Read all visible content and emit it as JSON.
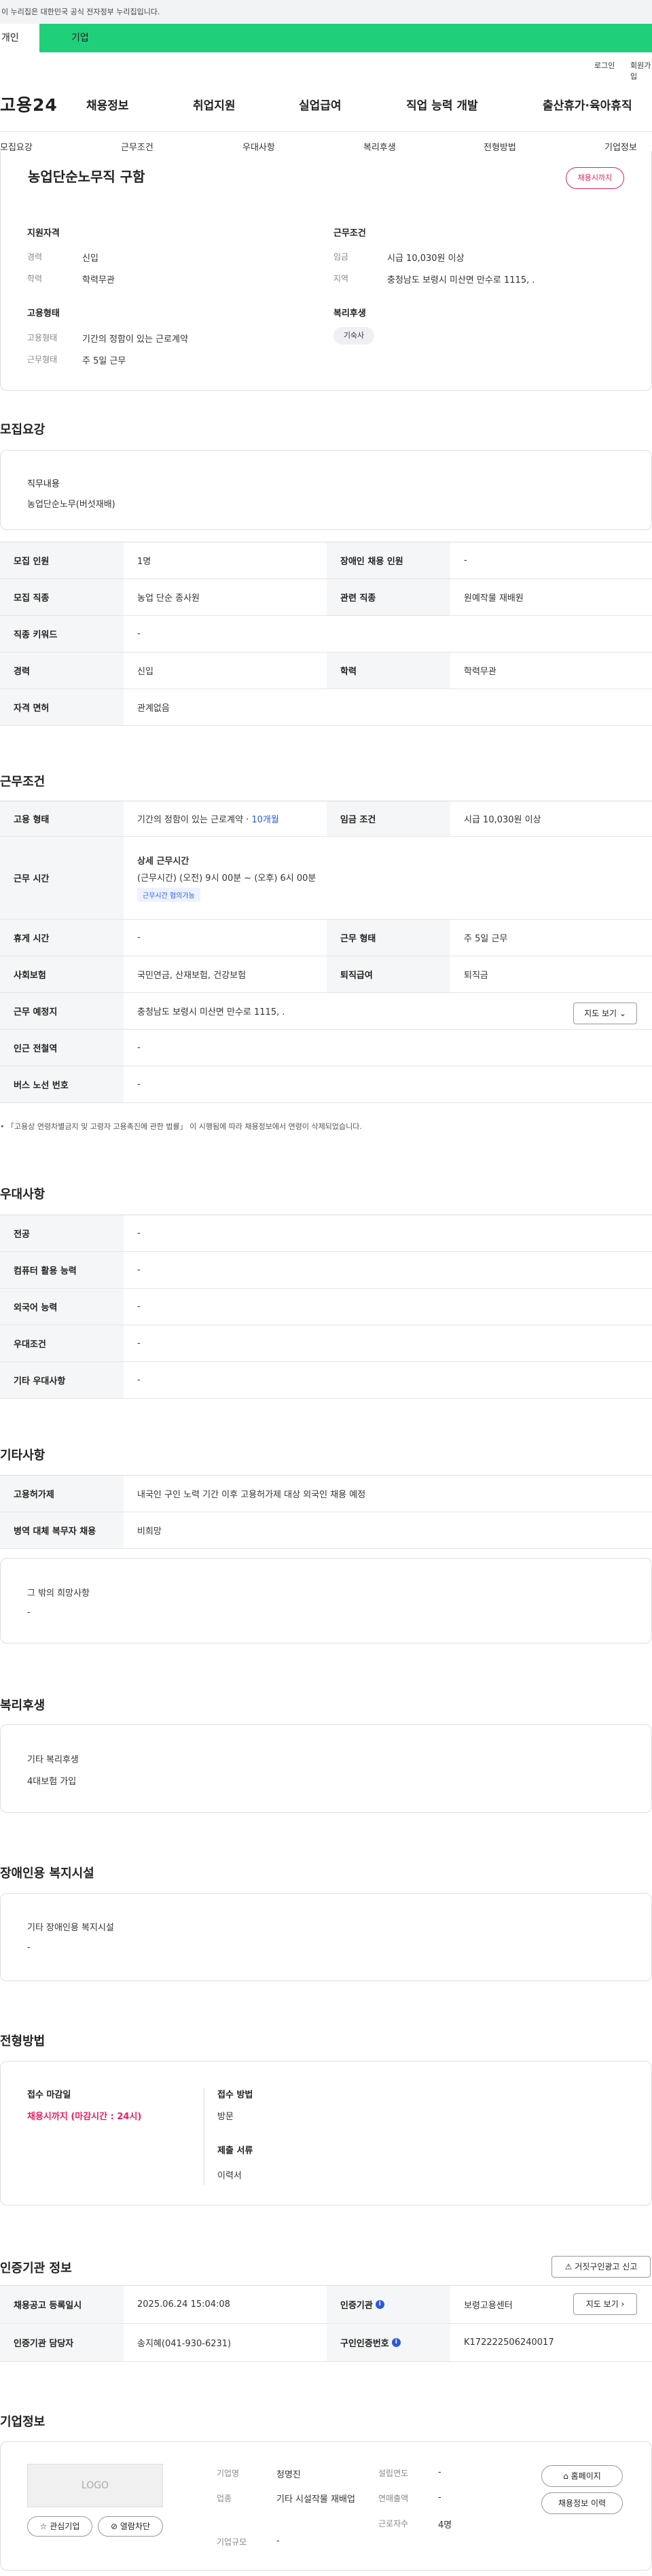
{
  "gov_banner": "이 누리집은 대한민국 공식 전자정부 누리집입니다.",
  "tabs": {
    "personal": "개인",
    "company": "기업"
  },
  "util": {
    "login": "로그인",
    "signup": "회원가입"
  },
  "logo": "고용24",
  "gnb": [
    "채용정보",
    "취업지원",
    "실업급여",
    "직업 능력 개발",
    "출산휴가·육아휴직"
  ],
  "subnav": [
    "모집요강",
    "근무조건",
    "우대사항",
    "복리후생",
    "전형방법",
    "기업정보"
  ],
  "summary": {
    "title": "농업단순노무직 구함",
    "status": "채용시까지",
    "qual_title": "지원자격",
    "career_k": "경력",
    "career_v": "신입",
    "edu_k": "학력",
    "edu_v": "학력무관",
    "cond_title": "근무조건",
    "wage_k": "임금",
    "wage_v": "시급 10,030원 이상",
    "area_k": "지역",
    "area_v": "충청남도 보령시 미산면 만수로 1115, .",
    "emp_title": "고용형태",
    "emptype_k": "고용형태",
    "emptype_v": "기간의 정함이 있는 근로계약",
    "workform_k": "근무형태",
    "workform_v": "주 5일 근무",
    "welfare_title": "복리후생",
    "welfare_chip": "기숙사"
  },
  "recruit": {
    "title": "모집요강",
    "duty_k": "직무내용",
    "duty_v": "농업단순노무(버섯재배)",
    "rows": [
      {
        "k1": "모집 인원",
        "v1": "1명",
        "k2": "장애인 채용 인원",
        "v2": "-"
      },
      {
        "k1": "모집 직종",
        "v1": "농업 단순 종사원",
        "k2": "관련 직종",
        "v2": "원예작물 재배원"
      },
      {
        "k1": "직종 키워드",
        "v1": "-"
      },
      {
        "k1": "경력",
        "v1": "신입",
        "k2": "학력",
        "v2": "학력무관"
      },
      {
        "k1": "자격 면허",
        "v1": "관계없음"
      }
    ]
  },
  "conditions": {
    "title": "근무조건",
    "emptype_k": "고용 형태",
    "emptype_v": "기간의 정함이 있는 근로계약 ·",
    "emptype_months": "10개월",
    "wage_k": "임금 조건",
    "wage_v": "시급 10,030원 이상",
    "hours_k": "근무 시간",
    "hours_title": "상세 근무시간",
    "hours_v": "(근무시간) (오전) 9시 00분 ~ (오후) 6시 00분",
    "hours_badge": "근무시간 협의가능",
    "rest_k": "휴게 시간",
    "rest_v": "-",
    "form_k": "근무 형태",
    "form_v": "주 5일 근무",
    "ins_k": "사회보험",
    "ins_v": "국민연금, 산재보험, 건강보험",
    "sev_k": "퇴직급여",
    "sev_v": "퇴직금",
    "loc_k": "근무 예정지",
    "loc_v": "충청남도 보령시 미산면 만수로 1115, .",
    "map_btn": "지도 보기",
    "subway_k": "인근 전철역",
    "subway_v": "-",
    "bus_k": "버스 노선 번호",
    "bus_v": "-",
    "note": "「고용상 연령차별금지 및 고령자 고용촉진에 관한 법률」 이 시행됨에 따라 채용정보에서 연령이 삭제되었습니다."
  },
  "preference": {
    "title": "우대사항",
    "rows": [
      {
        "k": "전공",
        "v": "-"
      },
      {
        "k": "컴퓨터 활용 능력",
        "v": "-"
      },
      {
        "k": "외국어 능력",
        "v": "-"
      },
      {
        "k": "우대조건",
        "v": "-"
      },
      {
        "k": "기타 우대사항",
        "v": "-"
      }
    ]
  },
  "etc": {
    "title": "기타사항",
    "rows": [
      {
        "k": "고용허가제",
        "v": "내국인 구인 노력 기간 이후 고용허가제 대상 외국인 채용 예정"
      },
      {
        "k": "병역 대체 복무자 채용",
        "v": "비희망"
      }
    ],
    "wish_k": "그 밖의 희망사항",
    "wish_v": "-"
  },
  "welfare": {
    "title": "복리후생",
    "k": "기타 복리후생",
    "v": "4대보험 가입"
  },
  "disabled": {
    "title": "장애인용 복지시설",
    "k": "기타 장애인용 복지시설",
    "v": "-"
  },
  "selection": {
    "title": "전형방법",
    "deadline_k": "접수 마감일",
    "deadline_v": "채용시까지 (마감시간 : 24시)",
    "method_k": "접수 방법",
    "method_v": "방문",
    "docs_k": "제출 서류",
    "docs_v": "이력서"
  },
  "agency": {
    "title": "인증기관 정보",
    "report_btn": "거짓구인광고 신고",
    "reg_k": "채용공고 등록일시",
    "reg_v": "2025.06.24 15:04:08",
    "agency_k": "인증기관",
    "agency_v": "보령고용센터",
    "map_btn": "지도 보기",
    "manager_k": "인증기관 담당자",
    "manager_v": "송지혜(041-930-6231)",
    "num_k": "구인인증번호",
    "num_v": "K172222506240017"
  },
  "company": {
    "title": "기업정보",
    "logo": "LOGO",
    "interest_btn": "관심기업",
    "block_btn": "열람차단",
    "name_k": "기업명",
    "name_v": "청명진",
    "industry_k": "업종",
    "industry_v": "기타 시설작물 재배업",
    "size_k": "기업규모",
    "size_v": "-",
    "founded_k": "설립연도",
    "founded_v": "-",
    "revenue_k": "연매출액",
    "revenue_v": "-",
    "staff_k": "근로자수",
    "staff_v": "4명",
    "home_btn": "홈페이지",
    "jobs_btn": "채용정보 이력"
  }
}
